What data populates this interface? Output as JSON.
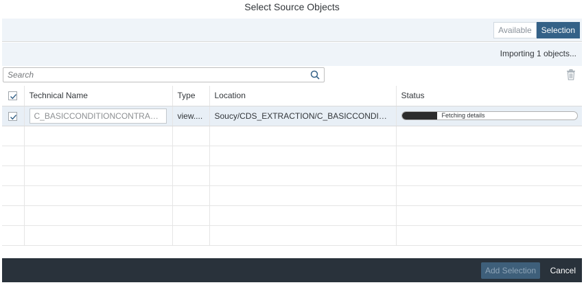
{
  "dialog": {
    "title": "Select Source Objects"
  },
  "view_toggle": {
    "available_label": "Available",
    "selection_label": "Selection",
    "active": "Selection"
  },
  "status_bar": {
    "importing_text": "Importing 1 objects..."
  },
  "search": {
    "placeholder": "Search",
    "value": ""
  },
  "icons": {
    "search": "search-icon",
    "delete": "trash-icon",
    "checkbox": "checkmark-icon"
  },
  "table": {
    "headers": {
      "technical_name": "Technical Name",
      "type": "Type",
      "location": "Location",
      "status": "Status"
    },
    "header_checked": true,
    "rows": [
      {
        "checked": true,
        "technical_name": "C_BASICCONDITIONCONTRAC...",
        "type": "view....",
        "location": "Soucy/CDS_EXTRACTION/C_BASICCONDITI...",
        "status_text": "Fetching details",
        "progress": 0.2
      }
    ],
    "empty_rows": 6
  },
  "footer": {
    "add_selection_label": "Add Selection",
    "cancel_label": "Cancel"
  },
  "colors": {
    "toolbar_bg": "#eff4f9",
    "active_toggle": "#346187",
    "footer_bg": "#29323b",
    "selected_row": "#e8eff6",
    "progress_fill": "#2c2c2c"
  }
}
